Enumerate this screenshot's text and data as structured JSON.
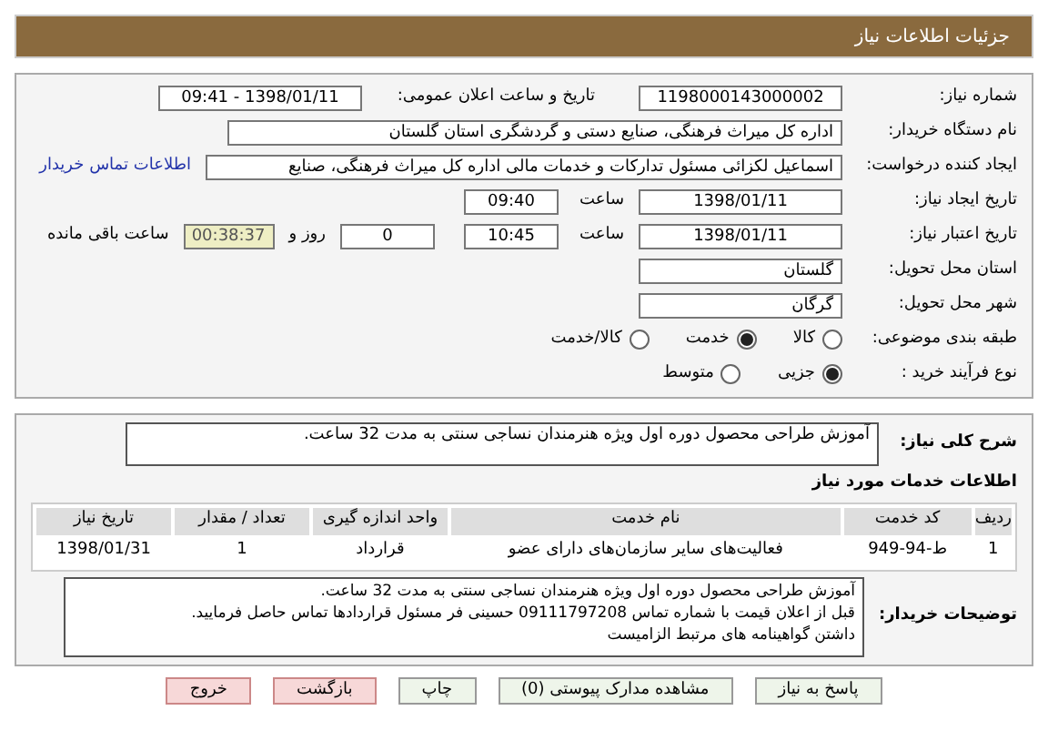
{
  "header": {
    "title": "جزئیات اطلاعات نیاز"
  },
  "need_number": {
    "label": "شماره نیاز:",
    "value": "1198000143000002"
  },
  "announce": {
    "label": "تاریخ و ساعت اعلان عمومی:",
    "value": "1398/01/11 - 09:41"
  },
  "buyer_org": {
    "label": "نام دستگاه خریدار:",
    "value": "اداره کل میراث فرهنگی، صنایع دستی و گردشگری استان گلستان"
  },
  "requester": {
    "label": "ایجاد کننده درخواست:",
    "value": "اسماعیل لکزائی مسئول تدارکات و خدمات مالی اداره کل میراث فرهنگی، صنایع",
    "link": "اطلاعات تماس خریدار"
  },
  "created": {
    "label": "تاریخ ایجاد نیاز:",
    "date": "1398/01/11",
    "time_label": "ساعت",
    "time": "09:40"
  },
  "validity": {
    "label": "تاریخ اعتبار نیاز:",
    "date": "1398/01/11",
    "time_label": "ساعت",
    "time": "10:45",
    "days": "0",
    "days_label": "روز و",
    "remaining": "00:38:37",
    "remaining_label": "ساعت باقی مانده"
  },
  "province": {
    "label": "استان محل تحویل:",
    "value": "گلستان"
  },
  "city": {
    "label": "شهر محل تحویل:",
    "value": "گرگان"
  },
  "category": {
    "label": "طبقه بندی موضوعی:",
    "options": [
      {
        "label": "کالا",
        "selected": false
      },
      {
        "label": "خدمت",
        "selected": true
      },
      {
        "label": "کالا/خدمت",
        "selected": false
      }
    ]
  },
  "purchase_type": {
    "label": "نوع فرآیند خرید :",
    "options": [
      {
        "label": "جزیی",
        "selected": true
      },
      {
        "label": "متوسط",
        "selected": false
      }
    ]
  },
  "summary": {
    "label": "شرح کلی نیاز:",
    "value": "آموزش طراحی محصول دوره اول ویژه هنرمندان نساجی سنتی به مدت 32 ساعت."
  },
  "services": {
    "title": "اطلاعات خدمات مورد نیاز",
    "columns": [
      "ردیف",
      "کد خدمت",
      "نام خدمت",
      "واحد اندازه گیری",
      "تعداد / مقدار",
      "تاریخ نیاز"
    ],
    "rows": [
      [
        "1",
        "ط-94-949",
        "فعالیت‌های سایر سازمان‌های دارای عضو",
        "قرارداد",
        "1",
        "1398/01/31"
      ]
    ]
  },
  "buyer_notes": {
    "label": "توضیحات خریدار:",
    "lines": [
      "آموزش طراحی محصول دوره اول ویژه هنرمندان نساجی سنتی به مدت 32 ساعت.",
      "قبل از اعلان قیمت با شماره تماس 09111797208 حسینی فر مسئول قراردادها تماس حاصل فرمایید.",
      "داشتن گواهینامه های مرتبط الزامیست"
    ]
  },
  "buttons": [
    {
      "label": "پاسخ به نیاز",
      "kind": "normal"
    },
    {
      "label": "مشاهده مدارک پیوستی (0)",
      "kind": "normal"
    },
    {
      "label": "چاپ",
      "kind": "normal"
    },
    {
      "label": "بازگشت",
      "kind": "danger"
    },
    {
      "label": "خروج",
      "kind": "danger"
    }
  ]
}
